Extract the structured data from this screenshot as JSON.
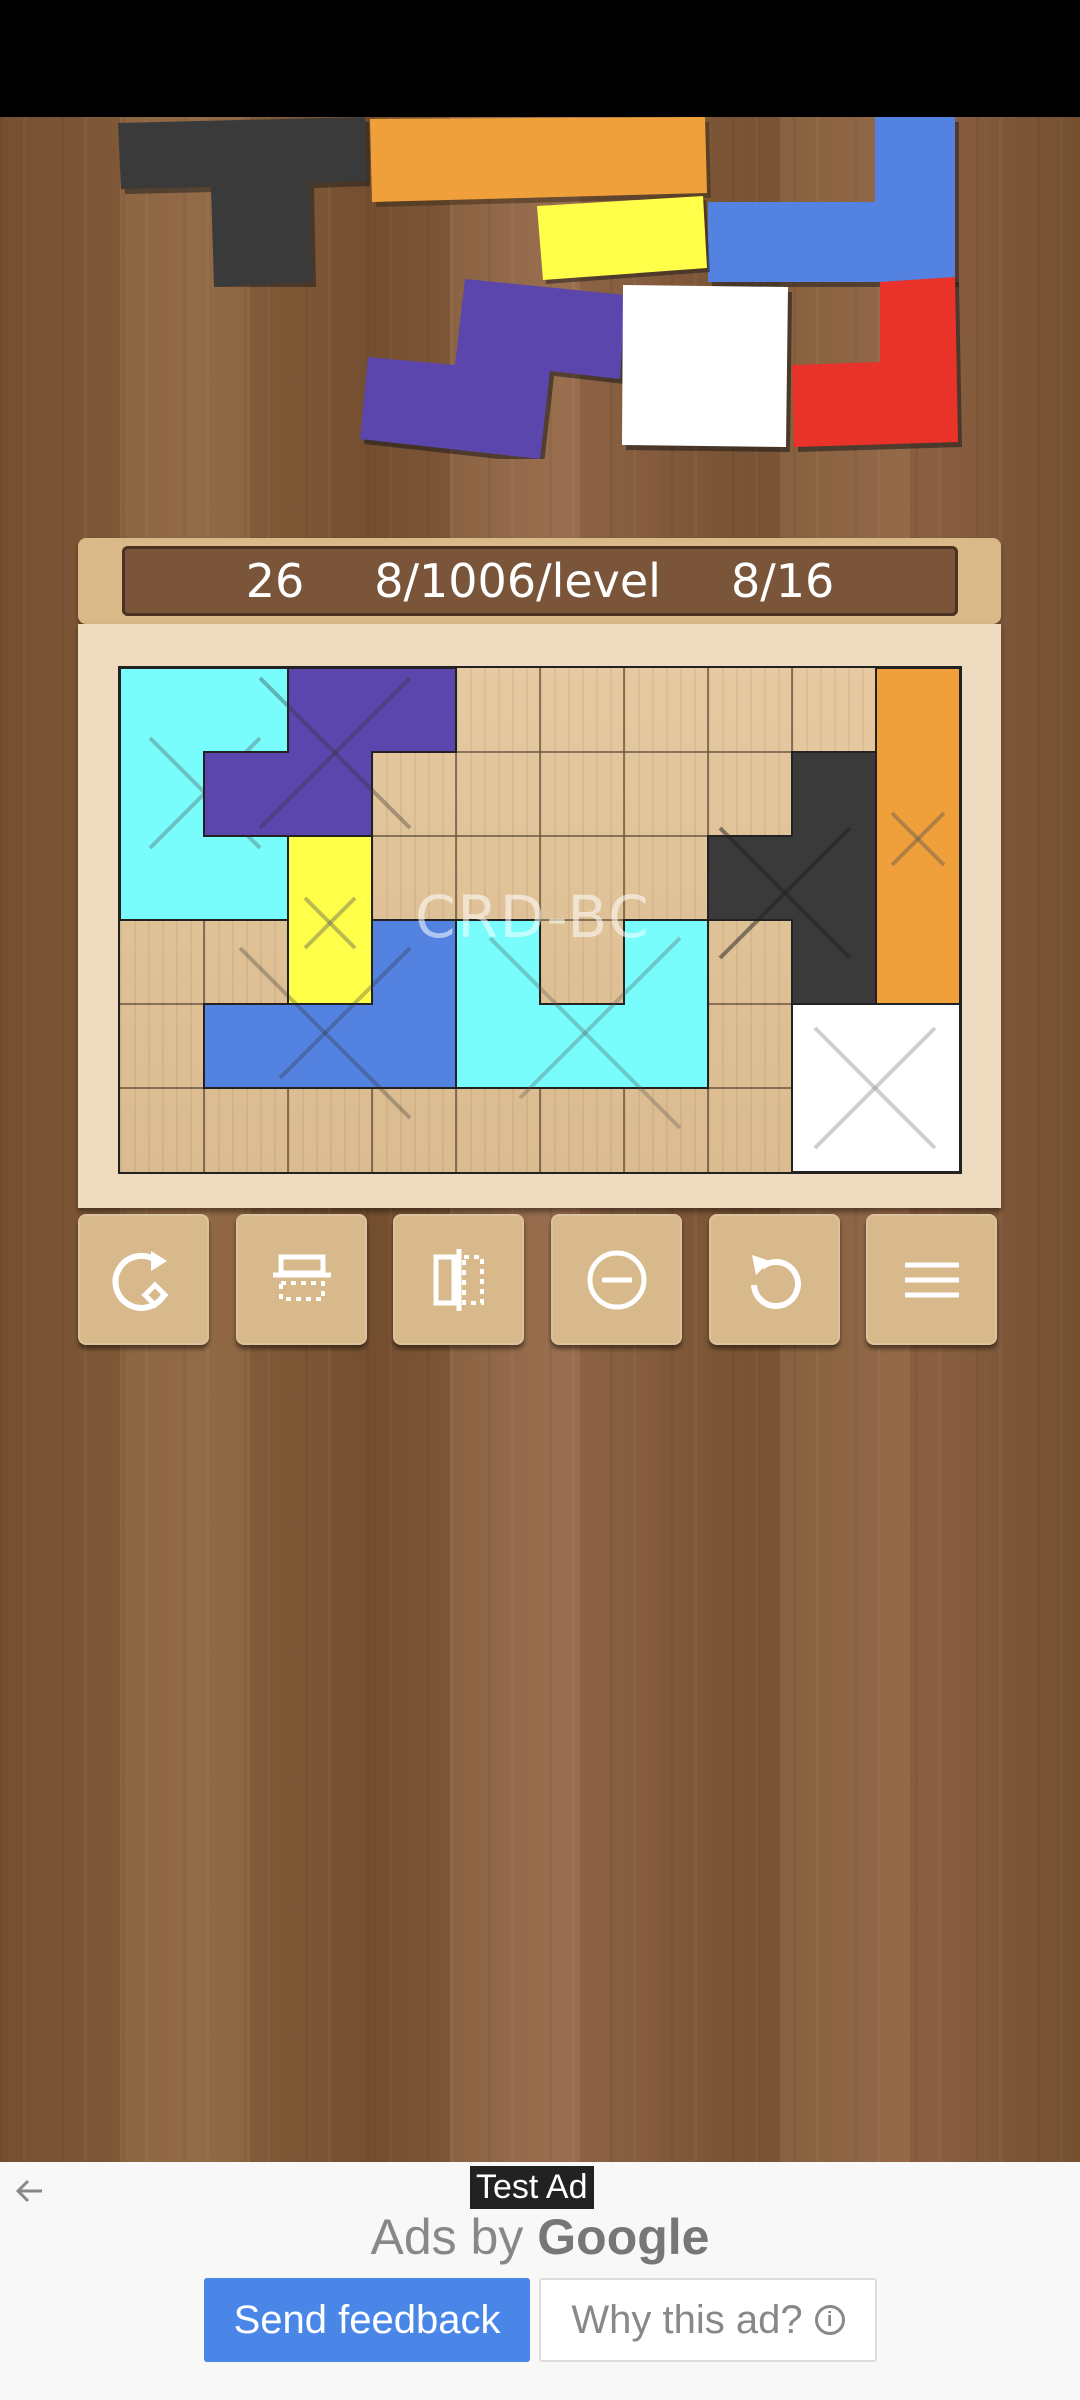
{
  "status_bar": {
    "background": "#000000"
  },
  "header": {
    "moves": "26",
    "progress": "8/1006/level",
    "pieces": "8/16"
  },
  "board": {
    "watermark": "CRD-BC",
    "columns": 10,
    "rows": 6
  },
  "tray_pieces": [
    {
      "color": "#3a3a3a",
      "name": "dark-t-piece"
    },
    {
      "color": "#f0a03a",
      "name": "orange-bar-piece"
    },
    {
      "color": "#5382e0",
      "name": "blue-l-piece"
    },
    {
      "color": "#ffff4a",
      "name": "yellow-domino-piece"
    },
    {
      "color": "#5b46ad",
      "name": "purple-z-piece"
    },
    {
      "color": "#ffffff",
      "name": "white-square-piece"
    },
    {
      "color": "#e8322a",
      "name": "red-l-piece"
    }
  ],
  "toolbar": [
    {
      "name": "rotate-button",
      "icon": "rotate-icon"
    },
    {
      "name": "flip-vertical-button",
      "icon": "flip-vertical-icon"
    },
    {
      "name": "flip-horizontal-button",
      "icon": "flip-horizontal-icon"
    },
    {
      "name": "remove-button",
      "icon": "minus-circle-icon"
    },
    {
      "name": "undo-button",
      "icon": "undo-icon"
    },
    {
      "name": "menu-button",
      "icon": "menu-icon"
    }
  ],
  "ad": {
    "badge": "Test Ad",
    "ads_by": "Ads by",
    "google": "Google",
    "send_feedback": "Send feedback",
    "why_this_ad": "Why this ad?"
  }
}
